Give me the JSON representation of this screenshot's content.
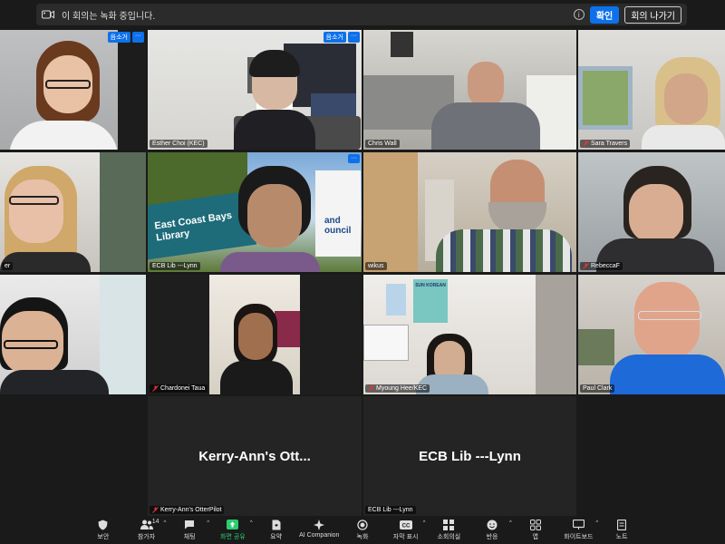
{
  "recording_bar": {
    "message": "이 회의는 녹화 중입니다.",
    "info": "i",
    "ok_label": "확인",
    "leave_label": "회의 나가기"
  },
  "tiles": [
    {
      "name": "",
      "tag": "음소거",
      "more": "···"
    },
    {
      "name": "Esther Choi (KEC)",
      "tag": "음소거",
      "more": "···"
    },
    {
      "name": "Chris Wall"
    },
    {
      "name": "Sara Travers"
    },
    {
      "name": "er"
    },
    {
      "name": "ECB Lib ---Lynn",
      "more": "···",
      "sign_line1": "East Coast Bays",
      "sign_line2": "Library",
      "sign2_line1": "and",
      "sign2_line2": "ouncil"
    },
    {
      "name": "wikus"
    },
    {
      "name": "RebeccaF"
    },
    {
      "name": ""
    },
    {
      "name": "Chardonei Taua"
    },
    {
      "name": "Myoung Hee/KEC",
      "poster": "SUN KOREAN"
    },
    {
      "name": "Paul Clark"
    },
    {
      "name": "Kerry-Ann's OtterPilot",
      "big": "Kerry-Ann's Ott..."
    },
    {
      "name": "ECB Lib ---Lynn",
      "big": "ECB Lib ---Lynn"
    }
  ],
  "toolbar": {
    "items": [
      {
        "label": "보안",
        "icon": "shield-icon"
      },
      {
        "label": "참가자",
        "icon": "participants-icon",
        "count": "14"
      },
      {
        "label": "채팅",
        "icon": "chat-icon"
      },
      {
        "label": "화면 공유",
        "icon": "share-screen-icon"
      },
      {
        "label": "요약",
        "icon": "summary-icon"
      },
      {
        "label": "AI Companion",
        "icon": "ai-companion-icon"
      },
      {
        "label": "녹화",
        "icon": "record-icon"
      },
      {
        "label": "자막 표시",
        "icon": "captions-icon"
      },
      {
        "label": "소회의실",
        "icon": "breakout-rooms-icon"
      },
      {
        "label": "반응",
        "icon": "reactions-icon"
      },
      {
        "label": "앱",
        "icon": "apps-icon"
      },
      {
        "label": "화이트보드",
        "icon": "whiteboard-icon"
      },
      {
        "label": "노트",
        "icon": "notes-icon"
      }
    ]
  }
}
